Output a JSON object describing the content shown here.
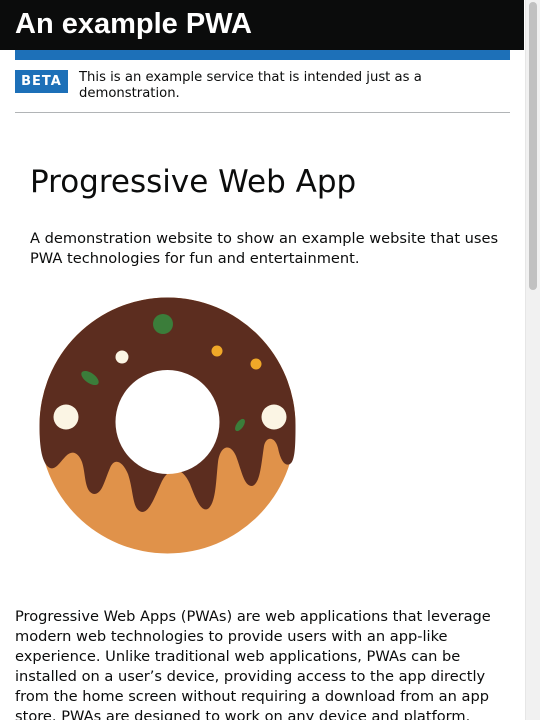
{
  "header": {
    "title": "An example PWA"
  },
  "phase_banner": {
    "tag": "BETA",
    "text": "This is an example service that is intended just as a demonstration."
  },
  "main": {
    "title": "Progressive Web App",
    "lead": "A demonstration website to show an example website that uses PWA technologies for fun and entertainment.",
    "illustration": "donut-illustration",
    "body": "Progressive Web Apps (PWAs) are web applications that leverage modern web technologies to provide users with an app-like experience. Unlike traditional web applications, PWAs can be installed on a user’s device, providing access to the app directly from the home screen without requiring a download from an app store. PWAs are designed to work on any device and platform."
  },
  "colors": {
    "header_bg": "#0b0c0c",
    "accent_blue": "#1d70b8",
    "chocolate": "#5c2d1f",
    "dough": "#e0924a",
    "sprinkle_green": "#3b7d3a",
    "sprinkle_yellow": "#f0a828",
    "sprinkle_cream": "#fbf5e4"
  }
}
